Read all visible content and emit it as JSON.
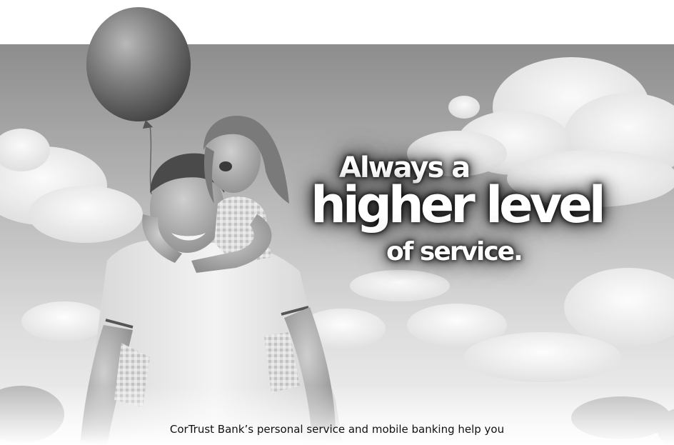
{
  "advert": {
    "headline": {
      "line1": "Always a",
      "line2": "higher level",
      "line3": "of service."
    },
    "caption": "CorTrust Bank’s personal service and mobile banking help you"
  }
}
